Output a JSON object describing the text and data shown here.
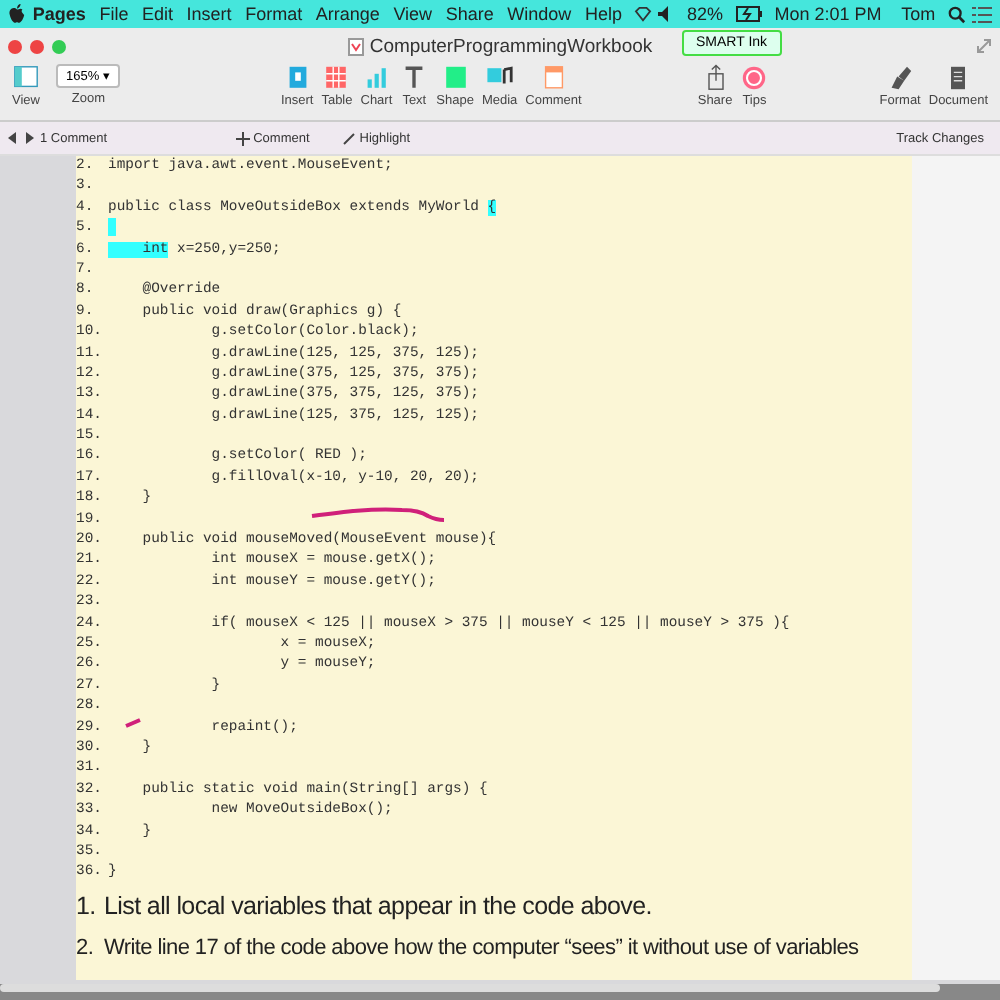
{
  "menu_bar": {
    "app": "Pages",
    "items": [
      "File",
      "Edit",
      "Insert",
      "Format",
      "Arrange",
      "View",
      "Share",
      "Window",
      "Help"
    ],
    "battery": "82%",
    "clock": "Mon 2:01 PM",
    "user": "Tom"
  },
  "window": {
    "title": "ComputerProgrammingWorkbook",
    "badge": "SMART Ink"
  },
  "toolbar": {
    "zoom": "165%",
    "zoom_caret": "▾",
    "left": [
      {
        "kind": "view",
        "label": "View"
      }
    ],
    "center": [
      {
        "kind": "insert",
        "label": "Insert"
      },
      {
        "kind": "table",
        "label": "Table"
      },
      {
        "kind": "chart",
        "label": "Chart"
      },
      {
        "kind": "text",
        "label": "Text"
      },
      {
        "kind": "shape",
        "label": "Shape"
      },
      {
        "kind": "media",
        "label": "Media"
      },
      {
        "kind": "comment",
        "label": "Comment"
      }
    ],
    "share": [
      {
        "kind": "share",
        "label": "Share"
      },
      {
        "kind": "tips",
        "label": "Tips"
      }
    ],
    "right": [
      {
        "kind": "format",
        "label": "Format"
      },
      {
        "kind": "document",
        "label": "Document"
      }
    ],
    "zoom_label": "Zoom"
  },
  "comment_bar": {
    "count": "1 Comment",
    "add": "Comment",
    "highlight": "Highlight",
    "track": "Track Changes"
  },
  "code": [
    {
      "number": "2.",
      "code": "import java.awt.event.MouseEvent;"
    },
    {
      "number": "3."
    },
    {
      "number": "4.",
      "code": [
        {
          "text": "public class MoveOutsideBox extends MyWorld ",
          "highlighted": false
        },
        {
          "text": "{",
          "highlighted": true
        }
      ]
    },
    {
      "number": "5.",
      "highlighted": true
    },
    {
      "number": "6.",
      "code": [
        {
          "text": "    int",
          "highlighted": true
        },
        {
          "text": " x=250,y=250;",
          "highlighted": false
        }
      ]
    },
    {
      "number": "7."
    },
    {
      "number": "8.",
      "code": "    @Override"
    },
    {
      "number": "9.",
      "code": "    public void draw(Graphics g) {"
    },
    {
      "number": "10.",
      "code": "            g.setColor(Color.black);"
    },
    {
      "number": "11.",
      "code": "            g.drawLine(125, 125, 375, 125);"
    },
    {
      "number": "12.",
      "code": "            g.drawLine(375, 125, 375, 375);"
    },
    {
      "number": "13.",
      "code": "            g.drawLine(375, 375, 125, 375);"
    },
    {
      "number": "14.",
      "code": "            g.drawLine(125, 375, 125, 125);"
    },
    {
      "number": "15."
    },
    {
      "number": "16.",
      "code": "            g.setColor( RED );"
    },
    {
      "number": "17.",
      "code": "            g.fillOval(x-10, y-10, 20, 20);"
    },
    {
      "number": "18.",
      "code": "    }"
    },
    {
      "number": "19."
    },
    {
      "number": "20.",
      "code": "    public void mouseMoved(MouseEvent mouse){"
    },
    {
      "number": "21.",
      "code": "            int mouseX = mouse.getX();"
    },
    {
      "number": "22.",
      "code": "            int mouseY = mouse.getY();"
    },
    {
      "number": "23."
    },
    {
      "number": "24.",
      "code": "            if( mouseX < 125 || mouseX > 375 || mouseY < 125 || mouseY > 375 ){"
    },
    {
      "number": "25.",
      "code": "                    x = mouseX;"
    },
    {
      "number": "26.",
      "code": "                    y = mouseY;"
    },
    {
      "number": "27.",
      "code": "            }"
    },
    {
      "number": "28."
    },
    {
      "number": "29.",
      "code": "            repaint();"
    },
    {
      "number": "30.",
      "code": "    }"
    },
    {
      "number": "31."
    },
    {
      "number": "32.",
      "code": "    public static void main(String[] args) {"
    },
    {
      "number": "33.",
      "code": "            new MoveOutsideBox();"
    },
    {
      "number": "34.",
      "code": "    }"
    },
    {
      "number": "35."
    },
    {
      "number": "36.",
      "code": "}"
    }
  ],
  "questions": [
    {
      "number": "1.",
      "text": "List all local variables that appear in the code above."
    },
    {
      "number": "2.",
      "text": "Write line 17 of the code above how the computer “sees” it without use of variables"
    }
  ]
}
